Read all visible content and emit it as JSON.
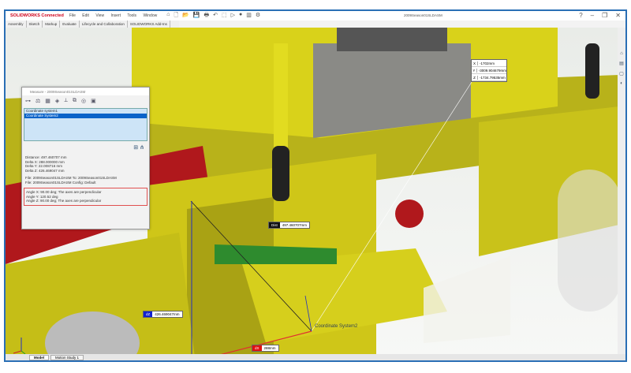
{
  "app": {
    "logo": "SOLIDWORKS Connected",
    "menu": [
      "File",
      "Edit",
      "View",
      "Insert",
      "Tools",
      "Window"
    ],
    "document_title": "2009Season01SLDASM",
    "quick_access": [
      "⌂",
      "🗋",
      "📂",
      "💾",
      "🖶",
      "↶",
      "⬚",
      "▷",
      "●",
      "▥",
      "⚙"
    ],
    "window_controls": [
      "?",
      "–",
      "❐",
      "✕"
    ]
  },
  "ribbon_tabs": [
    "Assembly",
    "Sketch",
    "Markup",
    "Evaluate",
    "Lifecycle and Collaboration",
    "SOLIDWORKS Add-Ins"
  ],
  "measure": {
    "title": "Measure - 2009Season01SLDASM",
    "list": [
      "Coordinate system1",
      "Coordinate System2"
    ],
    "selected_index": 1,
    "results": [
      "Distance: 497.460707 mm",
      "Delta X: 288.000000 mm",
      "Delta Y: 22.008716 mm",
      "Delta Z: 426.469047 mm"
    ],
    "files": [
      "File: 2009Season01SLDASM To: 2009Season01SLDASM",
      "File: 2009Season01SLDASM Config: Default"
    ],
    "angles": [
      "Angle X: 90.00 deg; The axes are perpendicular",
      "Angle Y: 120.52 deg",
      "Angle Z: 90.00 deg; The axes are perpendicular"
    ]
  },
  "callouts": {
    "dist": {
      "tag": "Dist",
      "value": "497.460707mm"
    },
    "dz": {
      "tag": "dZ",
      "value": "426.469047mm"
    },
    "dx": {
      "tag": "dX",
      "value": "288mm"
    }
  },
  "xyz": [
    {
      "axis": "X",
      "value": "-1702mm"
    },
    {
      "axis": "Y",
      "value": "-3009.904679mm"
    },
    {
      "axis": "Z",
      "value": "-1734.79535mm"
    }
  ],
  "coord_label": "Coordinate System2",
  "bottom_tabs": [
    "Model",
    "Motion Study 1"
  ],
  "colors": {
    "frame": "#2a6fb5",
    "part": "#d9d21a",
    "red": "#c8191f",
    "selection": "#0a63c9"
  }
}
